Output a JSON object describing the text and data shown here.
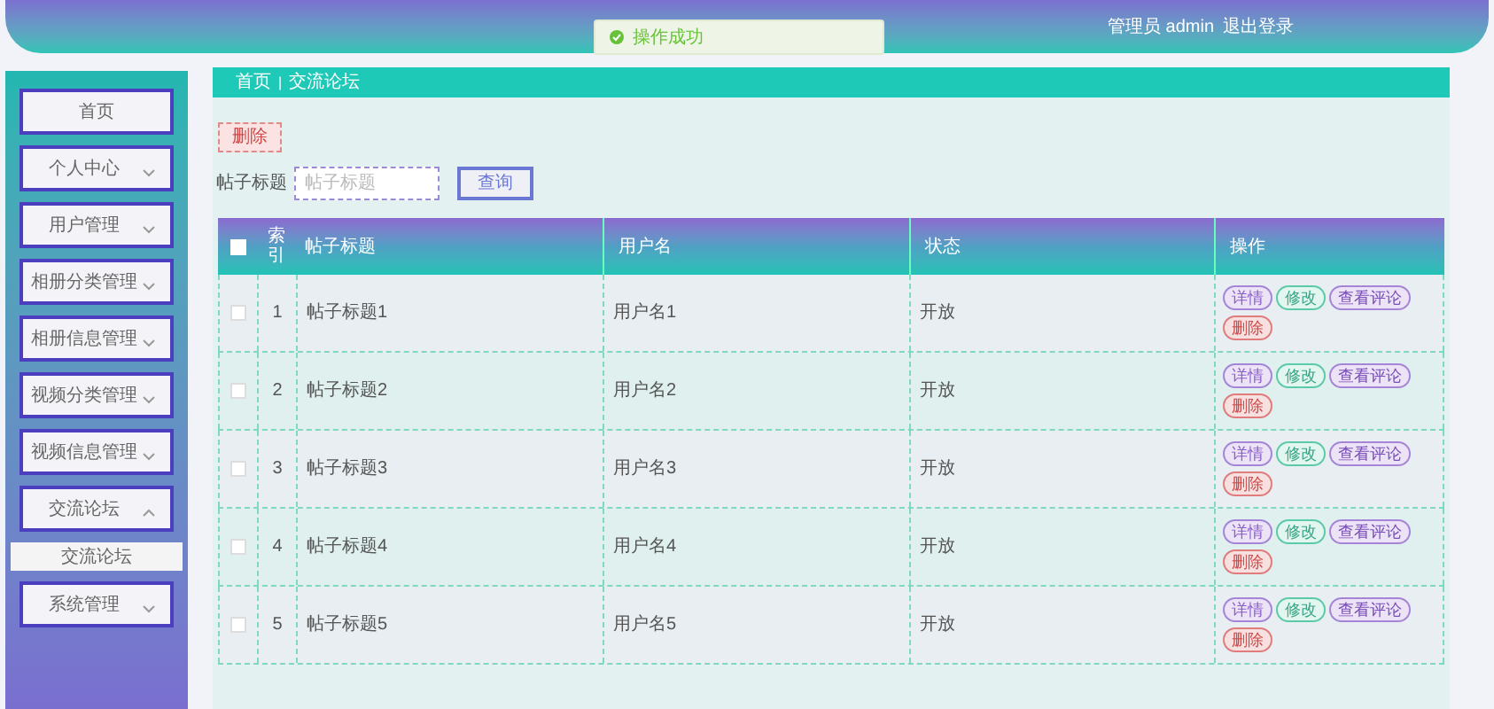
{
  "header": {
    "user_label": "管理员 admin",
    "logout": "退出登录"
  },
  "toast": {
    "text": "操作成功"
  },
  "sidebar": {
    "items": [
      {
        "label": "首页",
        "expandable": false,
        "selected": false
      },
      {
        "label": "个人中心",
        "expandable": true,
        "expanded": false,
        "selected": false
      },
      {
        "label": "用户管理",
        "expandable": true,
        "expanded": false,
        "selected": false
      },
      {
        "label": "相册分类管理",
        "expandable": true,
        "expanded": false,
        "selected": false
      },
      {
        "label": "相册信息管理",
        "expandable": true,
        "expanded": false,
        "selected": false
      },
      {
        "label": "视频分类管理",
        "expandable": true,
        "expanded": false,
        "selected": false
      },
      {
        "label": "视频信息管理",
        "expandable": true,
        "expanded": false,
        "selected": false
      },
      {
        "label": "交流论坛",
        "expandable": true,
        "expanded": true,
        "selected": false,
        "children": [
          {
            "label": "交流论坛",
            "selected": true
          }
        ]
      },
      {
        "label": "系统管理",
        "expandable": true,
        "expanded": false,
        "selected": false
      }
    ]
  },
  "breadcrumb": {
    "items": [
      "首页",
      "交流论坛"
    ],
    "separator": "|"
  },
  "delete_button": "删除",
  "search": {
    "label": "帖子标题",
    "placeholder": "帖子标题",
    "button": "查询"
  },
  "table": {
    "columns": [
      "索引",
      "帖子标题",
      "用户名",
      "状态",
      "操作"
    ],
    "header_checkbox": {
      "checked": false
    },
    "rows": [
      {
        "checked": false,
        "index": "1",
        "title": "帖子标题1",
        "user": "用户名1",
        "status": "开放",
        "actions": [
          {
            "label": "详情",
            "kind": "detail"
          },
          {
            "label": "修改",
            "kind": "edit"
          },
          {
            "label": "查看评论",
            "kind": "comments"
          },
          {
            "label": "删除",
            "kind": "delete"
          }
        ]
      },
      {
        "checked": false,
        "index": "2",
        "title": "帖子标题2",
        "user": "用户名2",
        "status": "开放",
        "actions": [
          {
            "label": "详情",
            "kind": "detail"
          },
          {
            "label": "修改",
            "kind": "edit"
          },
          {
            "label": "查看评论",
            "kind": "comments"
          },
          {
            "label": "删除",
            "kind": "delete"
          }
        ]
      },
      {
        "checked": false,
        "index": "3",
        "title": "帖子标题3",
        "user": "用户名3",
        "status": "开放",
        "actions": [
          {
            "label": "详情",
            "kind": "detail"
          },
          {
            "label": "修改",
            "kind": "edit"
          },
          {
            "label": "查看评论",
            "kind": "comments"
          },
          {
            "label": "删除",
            "kind": "delete"
          }
        ]
      },
      {
        "checked": false,
        "index": "4",
        "title": "帖子标题4",
        "user": "用户名4",
        "status": "开放",
        "actions": [
          {
            "label": "详情",
            "kind": "detail"
          },
          {
            "label": "修改",
            "kind": "edit"
          },
          {
            "label": "查看评论",
            "kind": "comments"
          },
          {
            "label": "删除",
            "kind": "delete"
          }
        ]
      },
      {
        "checked": false,
        "index": "5",
        "title": "帖子标题5",
        "user": "用户名5",
        "status": "开放",
        "actions": [
          {
            "label": "详情",
            "kind": "detail"
          },
          {
            "label": "修改",
            "kind": "edit"
          },
          {
            "label": "查看评论",
            "kind": "comments"
          },
          {
            "label": "删除",
            "kind": "delete"
          }
        ]
      }
    ]
  }
}
